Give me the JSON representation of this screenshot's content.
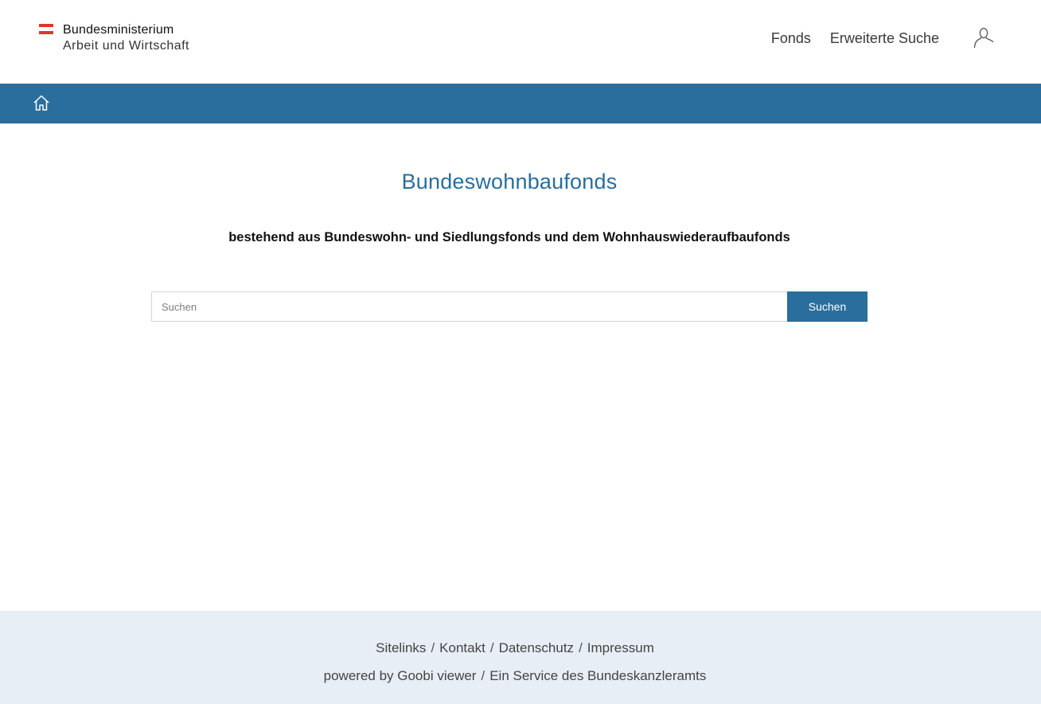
{
  "header": {
    "logo": {
      "line1": "Bundesministerium",
      "line2": "Arbeit und Wirtschaft"
    },
    "nav": {
      "fonds": "Fonds",
      "advanced_search": "Erweiterte Suche"
    },
    "user_icon": "user-icon"
  },
  "breadcrumb": {
    "home_icon": "home-icon"
  },
  "main": {
    "title": "Bundeswohnbaufonds",
    "subtitle": "bestehend aus Bundeswohn- und Siedlungsfonds und dem Wohnhauswiederaufbaufonds",
    "search": {
      "placeholder": "Suchen",
      "value": "",
      "button_label": "Suchen"
    }
  },
  "footer": {
    "row1": [
      "Sitelinks",
      "Kontakt",
      "Datenschutz",
      "Impressum"
    ],
    "row2": [
      "powered by Goobi viewer",
      "Ein Service des Bundeskanzleramts"
    ],
    "separator": "/"
  },
  "colors": {
    "brand_blue": "#2a6e9d",
    "flag_red": "#e0362b",
    "footer_bg": "#e8eef5"
  }
}
